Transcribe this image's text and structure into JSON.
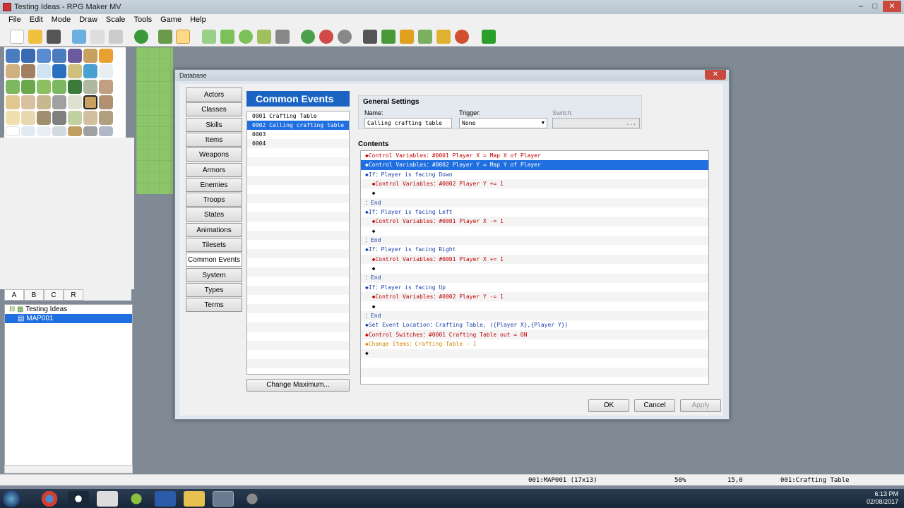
{
  "window": {
    "title": "Testing Ideas - RPG Maker MV"
  },
  "menu": [
    "File",
    "Edit",
    "Mode",
    "Draw",
    "Scale",
    "Tools",
    "Game",
    "Help"
  ],
  "map_tabs": [
    "A",
    "B",
    "C",
    "R"
  ],
  "map_tree": {
    "project": "Testing Ideas",
    "map": "MAP001"
  },
  "status": {
    "map": "001:MAP001 (17x13)",
    "zoom": "50%",
    "coords": "15,0",
    "event": "001:Crafting Table"
  },
  "clock": {
    "time": "6:13 PM",
    "date": "02/08/2017"
  },
  "dialog": {
    "title": "Database",
    "close_label": "✕",
    "categories": [
      "Actors",
      "Classes",
      "Skills",
      "Items",
      "Weapons",
      "Armors",
      "Enemies",
      "Troops",
      "States",
      "Animations",
      "Tilesets",
      "Common Events",
      "System",
      "Types",
      "Terms"
    ],
    "active_category": "Common Events",
    "panel_title": "Common Events",
    "events": [
      "0001 Crafting Table",
      "0002 Calling crafting table",
      "0003",
      "0004"
    ],
    "change_max": "Change Maximum...",
    "general_settings": "General Settings",
    "name_label": "Name:",
    "name_value": "Calling crafting table",
    "trigger_label": "Trigger:",
    "trigger_value": "None",
    "switch_label": "Switch:",
    "switch_btn": "...",
    "contents_label": "Contents",
    "ok": "OK",
    "cancel": "Cancel",
    "apply": "Apply",
    "lines": [
      {
        "text": "◆Control Variables：#0001 Player X = Map X of Player",
        "color": "red"
      },
      {
        "text": "◆Control Variables：#0002 Player Y = Map Y of Player",
        "color": "red",
        "selected": true
      },
      {
        "text": "◆If：Player is facing Down",
        "color": "blue"
      },
      {
        "text": "  ◆Control Variables：#0002 Player Y += 1",
        "color": "red"
      },
      {
        "text": "  ◆",
        "color": "blk"
      },
      {
        "text": "：End",
        "color": "blue"
      },
      {
        "text": "◆If：Player is facing Left",
        "color": "blue"
      },
      {
        "text": "  ◆Control Variables：#0001 Player X -= 1",
        "color": "red"
      },
      {
        "text": "  ◆",
        "color": "blk"
      },
      {
        "text": "：End",
        "color": "blue"
      },
      {
        "text": "◆If：Player is facing Right",
        "color": "blue"
      },
      {
        "text": "  ◆Control Variables：#0001 Player X += 1",
        "color": "red"
      },
      {
        "text": "  ◆",
        "color": "blk"
      },
      {
        "text": "：End",
        "color": "blue"
      },
      {
        "text": "◆If：Player is facing Up",
        "color": "blue"
      },
      {
        "text": "  ◆Control Variables：#0002 Player Y -= 1",
        "color": "red"
      },
      {
        "text": "  ◆",
        "color": "blk"
      },
      {
        "text": "：End",
        "color": "blue"
      },
      {
        "text": "◆Set Event Location：Crafting Table, ({Player X},{Player Y})",
        "color": "blue"
      },
      {
        "text": "◆Control Switches：#0001 Crafting Table out = ON",
        "color": "red"
      },
      {
        "text": "◆Change Items：Crafting Table - 1",
        "color": "orange"
      },
      {
        "text": "◆",
        "color": "blk"
      }
    ]
  }
}
